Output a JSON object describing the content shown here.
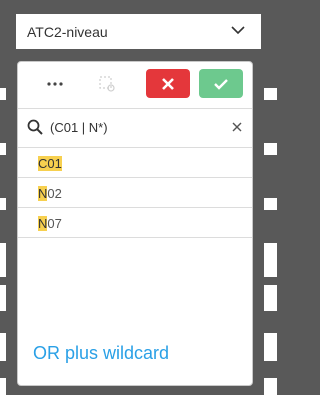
{
  "dropdown": {
    "title": "ATC2-niveau"
  },
  "toolbar": {
    "more_icon": "more-dots-icon",
    "tag_icon": "tag-icon",
    "cancel_icon": "x-icon",
    "confirm_icon": "check-icon",
    "cancel_color": "#e4373b",
    "confirm_color": "#6dc98e"
  },
  "search": {
    "value": "(C01 | N*)",
    "icon": "search-icon",
    "clear_icon": "close-icon"
  },
  "list": {
    "items": [
      {
        "match": "C01",
        "rest": ""
      },
      {
        "match": "N",
        "rest": "02"
      },
      {
        "match": "N",
        "rest": "07"
      }
    ]
  },
  "hint": "OR plus wildcard",
  "colors": {
    "highlight": "#f7d04f",
    "hint": "#2aa0e6",
    "background": "#595959"
  }
}
